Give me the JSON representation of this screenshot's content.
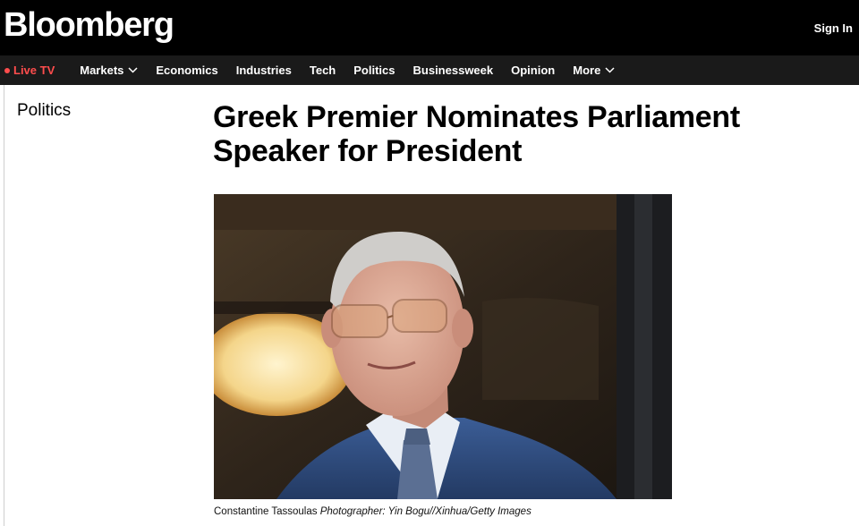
{
  "header": {
    "logo": "Bloomberg",
    "sign_in": "Sign In"
  },
  "nav": {
    "live": "Live TV",
    "items": [
      {
        "label": "Markets",
        "dropdown": true
      },
      {
        "label": "Economics"
      },
      {
        "label": "Industries"
      },
      {
        "label": "Tech"
      },
      {
        "label": "Politics"
      },
      {
        "label": "Businessweek"
      },
      {
        "label": "Opinion"
      },
      {
        "label": "More",
        "dropdown": true
      }
    ]
  },
  "article": {
    "section": "Politics",
    "headline": "Greek Premier Nominates Parliament Speaker for President",
    "image": {
      "caption_name": "Constantine Tassoulas",
      "caption_credit": "Photographer: Yin Bogu//Xinhua/Getty Images"
    }
  },
  "colors": {
    "topbar": "#000000",
    "navbar": "#1a1a1a",
    "live_accent": "#ff4d4d"
  },
  "icons": {
    "live_dot": "live-dot-icon",
    "dropdown": "chevron-down-icon"
  }
}
